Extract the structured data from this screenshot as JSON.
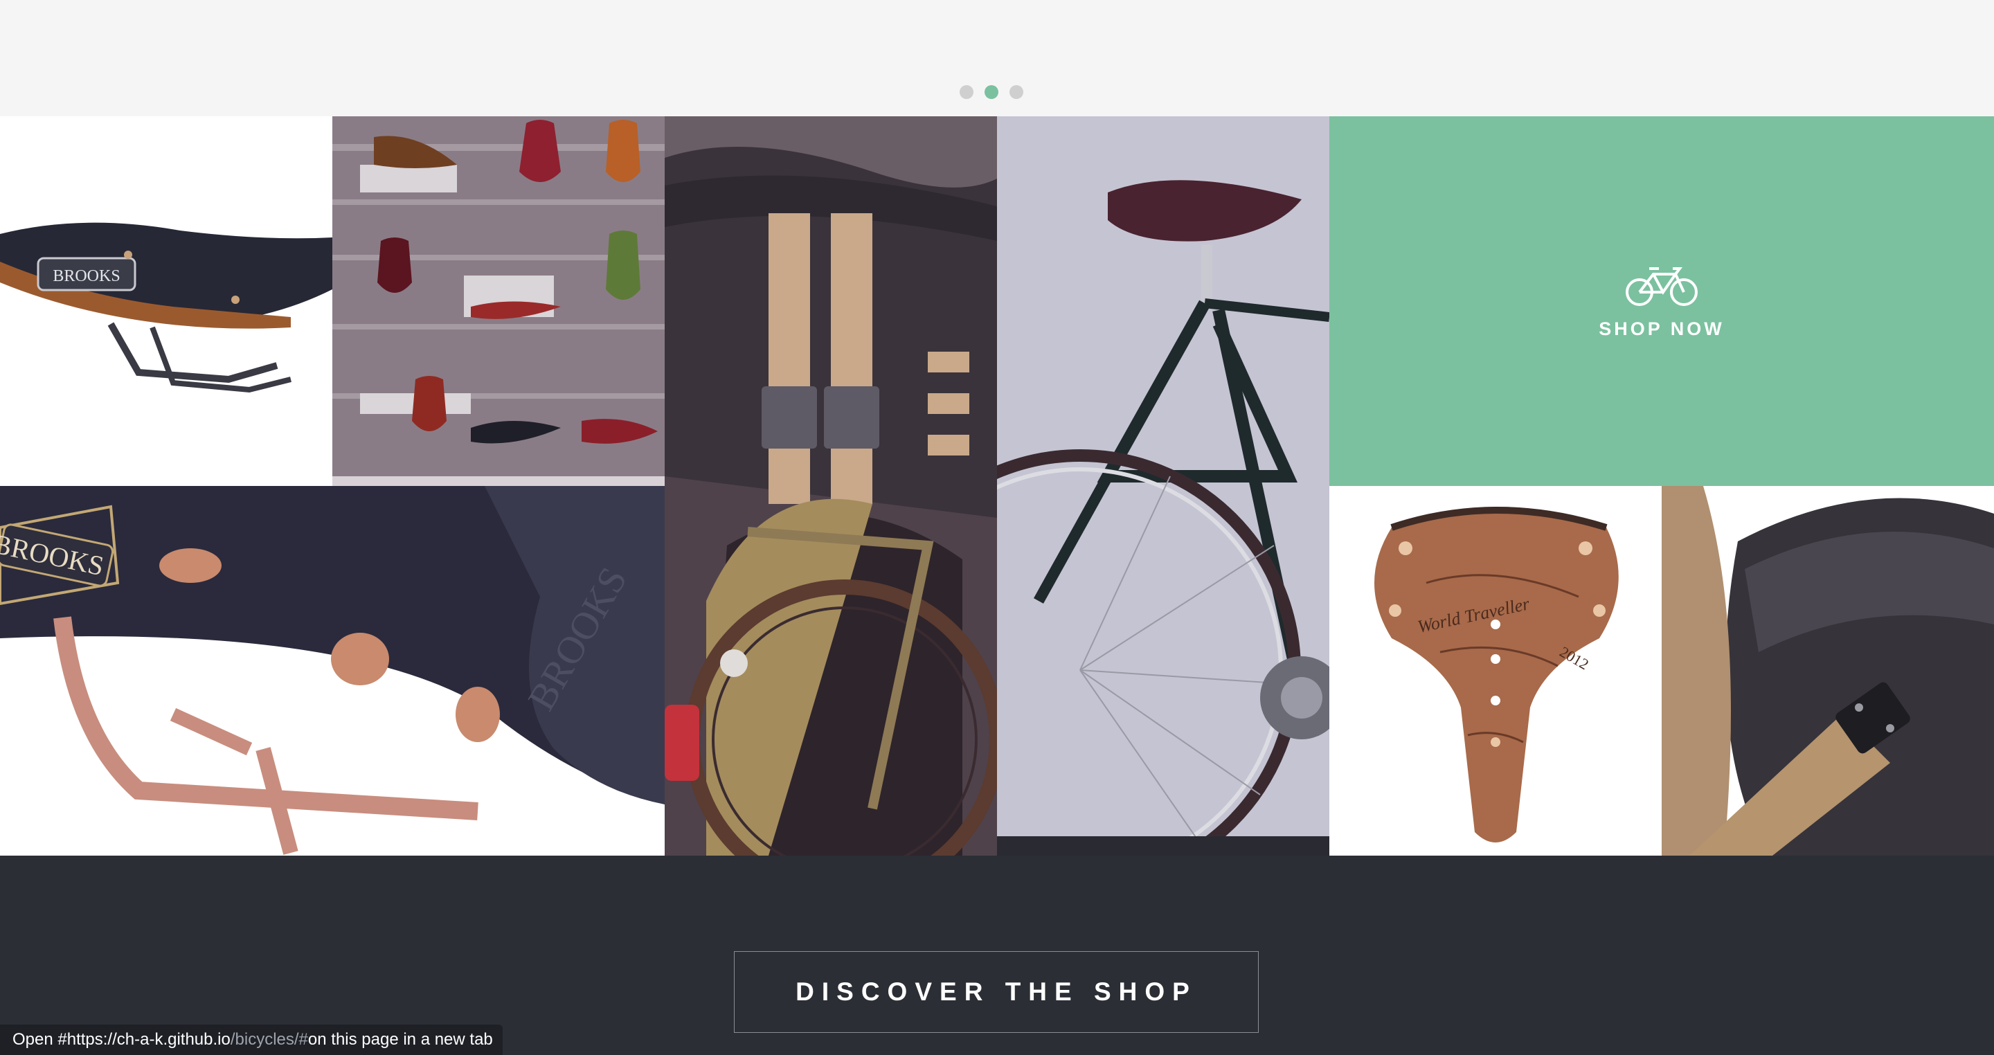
{
  "carousel": {
    "dots": [
      {
        "active": false
      },
      {
        "active": true
      },
      {
        "active": false
      }
    ],
    "active_color": "#7bc19f",
    "inactive_color": "#cfcfcf"
  },
  "gallery": {
    "tiles": [
      {
        "name": "saddle-side-photo",
        "brand_text": "BROOKS"
      },
      {
        "name": "saddle-wall-display-photo"
      },
      {
        "name": "bike-bag-rack-photo"
      },
      {
        "name": "road-bike-photo"
      },
      {
        "name": "shop-now-tile"
      },
      {
        "name": "saddle-closeup-photo",
        "brand_text": "BROOKS"
      },
      {
        "name": "copper-saddle-photo",
        "engraving_text": "World Traveller",
        "year_text": "2012"
      },
      {
        "name": "messenger-bag-photo"
      }
    ],
    "shop_now": {
      "label": "SHOP NOW",
      "icon": "bicycle-icon",
      "bg_color": "#7bc19f"
    }
  },
  "footer": {
    "discover_label": "DISCOVER THE SHOP",
    "bg_color": "#2b2e35"
  },
  "status_bar": {
    "prefix": "Open #https://ch-a-k.github.io",
    "path": "/bicycles/#",
    "suffix": " on this page in a new tab"
  }
}
